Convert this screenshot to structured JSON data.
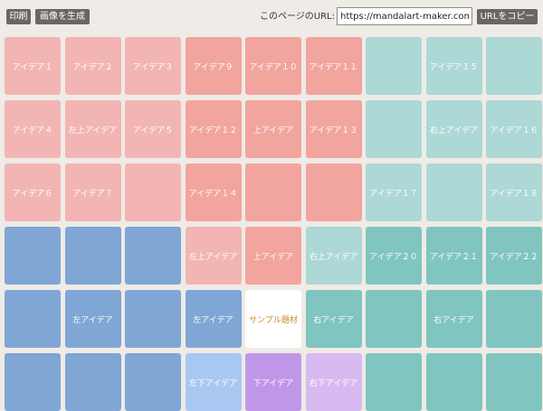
{
  "toolbar": {
    "print_label": "印刷",
    "generate_image_label": "画像を生成",
    "url_label": "このページのURL:",
    "url_value": "https://mandalart-maker.com/",
    "copy_url_label": "URLをコピー"
  },
  "colors": {
    "background": "#efebe6",
    "pink": "#f2b5b3",
    "salmon": "#f2a49f",
    "teal_light": "#acd8d6",
    "teal": "#80c5bf",
    "blue": "#7fa6d5",
    "blue_light": "#a8c8f1",
    "purple": "#c097e8",
    "lavender": "#d9baf0",
    "center_text": "#c98a2a"
  },
  "grid": {
    "rows": [
      [
        {
          "label": "アイデア１",
          "color": "pink"
        },
        {
          "label": "アイデア２",
          "color": "pink"
        },
        {
          "label": "アイデア３",
          "color": "pink"
        },
        {
          "label": "アイデア９",
          "color": "salmon"
        },
        {
          "label": "アイデア１０",
          "color": "salmon"
        },
        {
          "label": "アイデア１１",
          "color": "salmon"
        },
        {
          "label": "",
          "color": "teal-light"
        },
        {
          "label": "アイデア１５",
          "color": "teal-light"
        },
        {
          "label": "",
          "color": "teal-light"
        }
      ],
      [
        {
          "label": "アイデア４",
          "color": "pink"
        },
        {
          "label": "左上アイデア",
          "color": "pink"
        },
        {
          "label": "アイデア５",
          "color": "pink"
        },
        {
          "label": "アイデア１２",
          "color": "salmon"
        },
        {
          "label": "上アイデア",
          "color": "salmon"
        },
        {
          "label": "アイデア１３",
          "color": "salmon"
        },
        {
          "label": "",
          "color": "teal-light"
        },
        {
          "label": "右上アイデア",
          "color": "teal-light"
        },
        {
          "label": "アイデア１６",
          "color": "teal-light"
        }
      ],
      [
        {
          "label": "アイデア６",
          "color": "pink"
        },
        {
          "label": "アイデア７",
          "color": "pink"
        },
        {
          "label": "",
          "color": "pink"
        },
        {
          "label": "アイデア１４",
          "color": "salmon"
        },
        {
          "label": "",
          "color": "salmon"
        },
        {
          "label": "",
          "color": "salmon"
        },
        {
          "label": "アイデア１７",
          "color": "teal-light"
        },
        {
          "label": "",
          "color": "teal-light"
        },
        {
          "label": "アイデア１８",
          "color": "teal-light"
        }
      ],
      [
        {
          "label": "",
          "color": "blue"
        },
        {
          "label": "",
          "color": "blue"
        },
        {
          "label": "",
          "color": "blue"
        },
        {
          "label": "左上アイデア",
          "color": "pink"
        },
        {
          "label": "上アイデア",
          "color": "salmon"
        },
        {
          "label": "右上アイデア",
          "color": "teal-light"
        },
        {
          "label": "アイデア２０",
          "color": "teal"
        },
        {
          "label": "アイデア２１",
          "color": "teal"
        },
        {
          "label": "アイデア２２",
          "color": "teal"
        }
      ],
      [
        {
          "label": "",
          "color": "blue"
        },
        {
          "label": "左アイデア",
          "color": "blue"
        },
        {
          "label": "",
          "color": "blue"
        },
        {
          "label": "左アイデア",
          "color": "blue"
        },
        {
          "label": "サンプル題材",
          "color": "white"
        },
        {
          "label": "右アイデア",
          "color": "teal"
        },
        {
          "label": "",
          "color": "teal"
        },
        {
          "label": "右アイデア",
          "color": "teal"
        },
        {
          "label": "",
          "color": "teal"
        }
      ],
      [
        {
          "label": "",
          "color": "blue"
        },
        {
          "label": "",
          "color": "blue"
        },
        {
          "label": "",
          "color": "blue"
        },
        {
          "label": "左下アイデア",
          "color": "blue-light"
        },
        {
          "label": "下アイデア",
          "color": "purple"
        },
        {
          "label": "右下アイデア",
          "color": "lavender"
        },
        {
          "label": "",
          "color": "teal"
        },
        {
          "label": "",
          "color": "teal"
        },
        {
          "label": "",
          "color": "teal"
        }
      ]
    ]
  }
}
